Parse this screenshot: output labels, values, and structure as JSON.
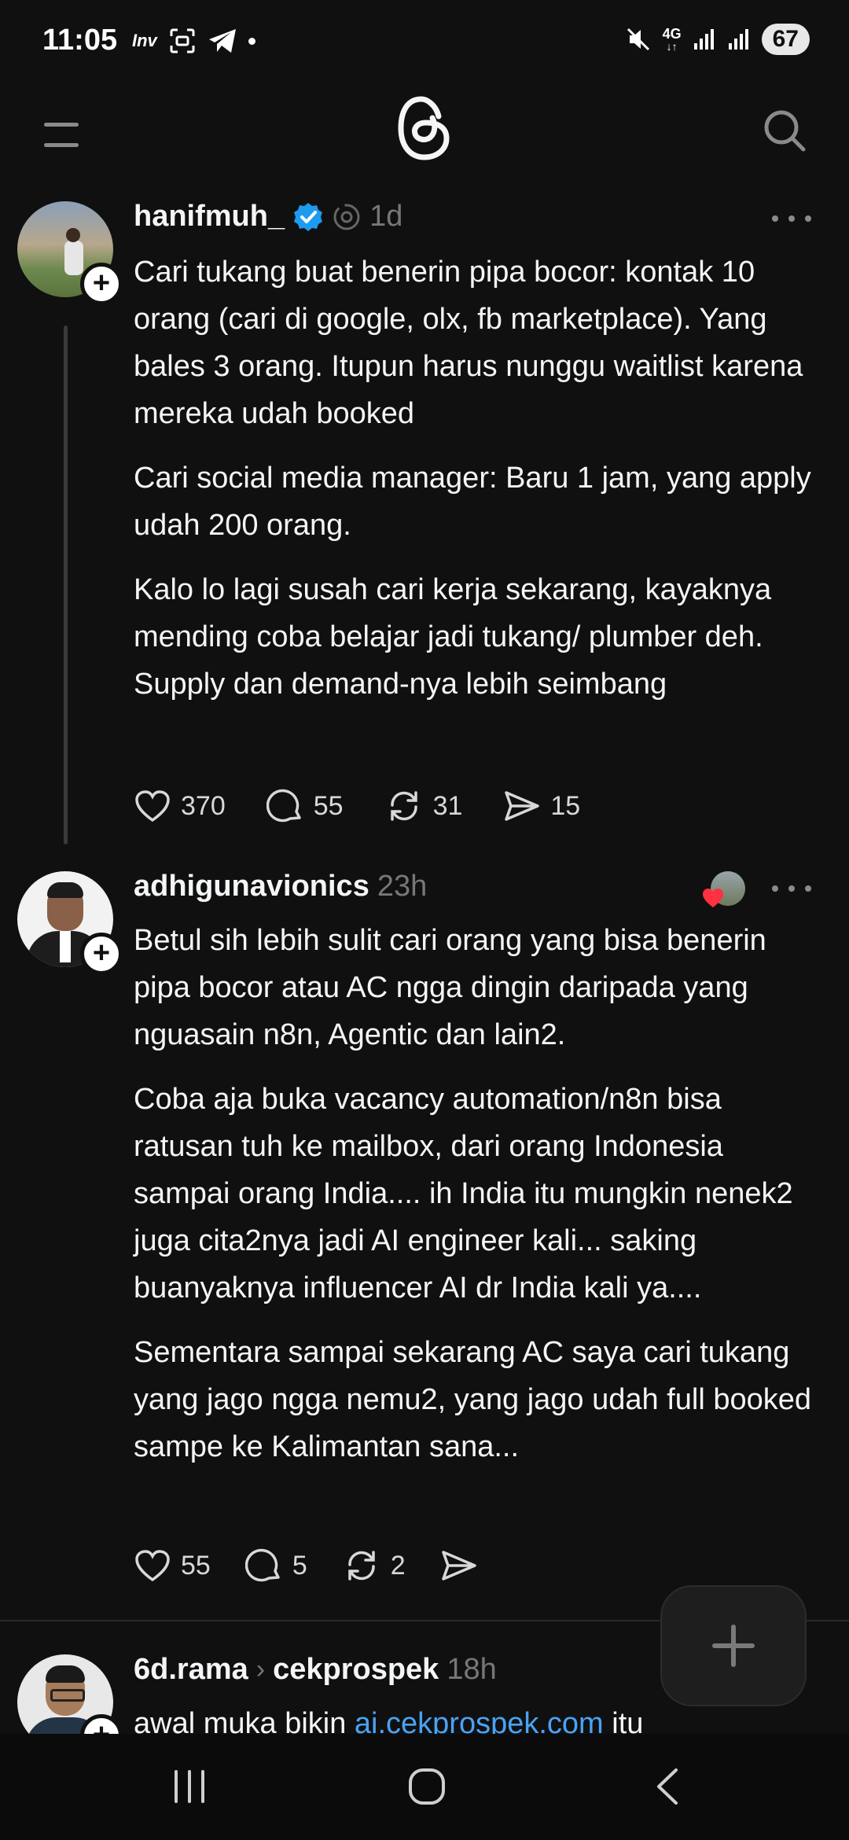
{
  "status_bar": {
    "time": "11:05",
    "notification_icons": [
      "invest-app-icon",
      "scan-icon",
      "telegram-icon",
      "dot-icon"
    ],
    "network_label": "4G",
    "battery": "67",
    "mute": true
  },
  "header": {
    "menu_icon": "hamburger-icon",
    "logo_icon": "threads-logo-icon",
    "search_icon": "search-icon"
  },
  "posts": [
    {
      "username": "hanifmuh_",
      "verified": true,
      "time": "1d",
      "paragraphs": [
        "Cari tukang buat benerin pipa bocor: kontak 10 orang (cari di google, olx, fb marketplace). Yang bales 3 orang. Itupun harus nunggu waitlist karena mereka udah booked",
        "Cari social media manager: Baru 1 jam, yang apply udah 200 orang.",
        "Kalo lo lagi susah cari kerja sekarang, kayaknya mending coba belajar jadi tukang/ plumber deh. Supply dan demand-nya lebih seimbang"
      ],
      "likes": "370",
      "replies": "55",
      "reposts": "31",
      "shares": "15"
    },
    {
      "username": "adhigunavionics",
      "time": "23h",
      "paragraphs": [
        "Betul sih lebih sulit cari orang yang bisa benerin pipa bocor atau AC ngga dingin daripada yang nguasain n8n, Agentic dan lain2.",
        "Coba aja buka vacancy automation/n8n bisa ratusan tuh ke mailbox, dari orang Indonesia sampai orang India.... ih India itu mungkin nenek2 juga cita2nya jadi AI engineer kali... saking buanyaknya influencer AI dr India kali ya....",
        "Sementara sampai sekarang AC saya cari tukang yang jago ngga nemu2, yang jago udah full booked sampe ke Kalimantan sana..."
      ],
      "likes": "55",
      "replies": "5",
      "reposts": "2"
    },
    {
      "username": "6d.rama",
      "reply_to": "cekprospek",
      "time": "18h",
      "text_before": "awal muka bikin ",
      "link": "ai.cekprospek.com",
      "text_after": " itu"
    }
  ],
  "fab": {
    "icon": "plus-icon"
  },
  "navbar": {
    "icons": [
      "recent-apps-icon",
      "home-icon",
      "back-icon"
    ]
  }
}
